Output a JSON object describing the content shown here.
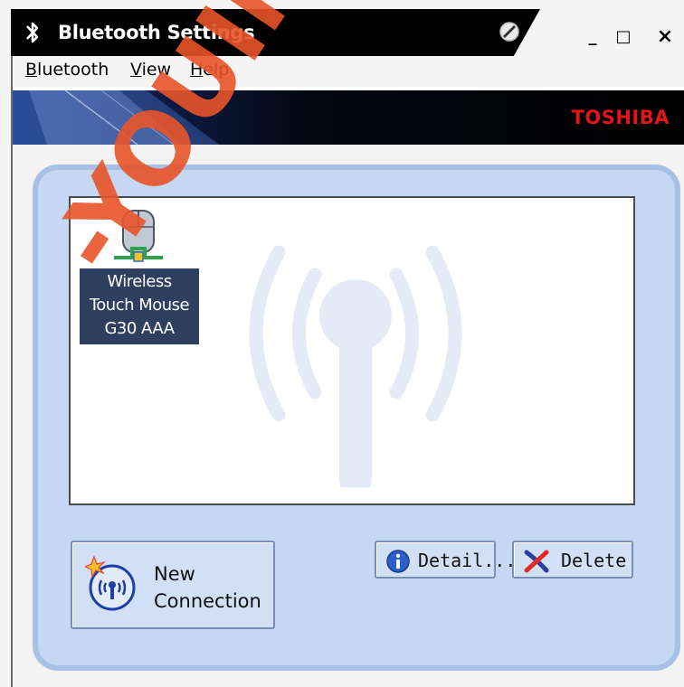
{
  "window": {
    "title": "Bluetooth Settings",
    "controls": {
      "minimize": "_",
      "maximize": "□",
      "close": "×"
    }
  },
  "menu": {
    "items": [
      {
        "ul": "B",
        "rest": "luetooth"
      },
      {
        "ul": "V",
        "rest": "iew"
      },
      {
        "ul": "H",
        "rest": "elp"
      }
    ]
  },
  "banner": {
    "brand": "TOSHIBA",
    "brand_color": "#e4141b"
  },
  "devices": [
    {
      "name_line1": "Wireless",
      "name_line2": "Touch Mouse",
      "name_line3": "G30 AAA",
      "icon": "mouse-icon",
      "selected": true
    }
  ],
  "buttons": {
    "new_connection_line1": "New",
    "new_connection_line2": "Connection",
    "detail": "Detail...",
    "delete": "Delete"
  },
  "watermark": {
    "text": "-YOUIN"
  },
  "colors": {
    "panel": "#c5d7f2",
    "panel_border": "#a9c0e6",
    "selection": "#2f3f5f",
    "watermark": "#e8542a"
  }
}
